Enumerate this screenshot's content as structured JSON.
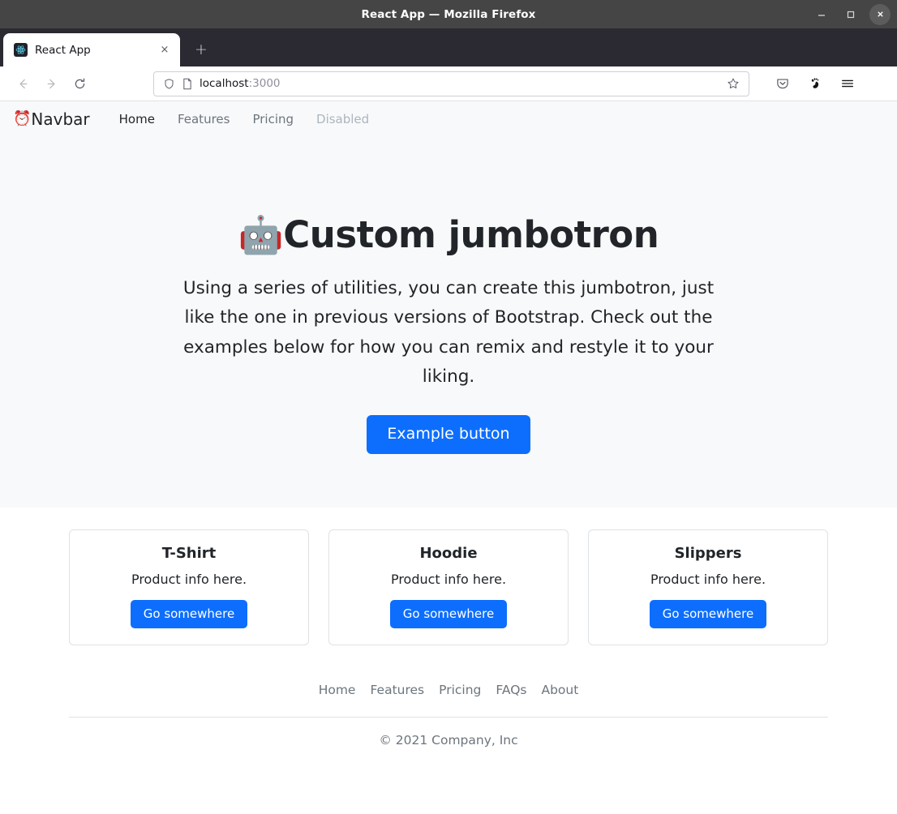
{
  "window": {
    "title": "React App — Mozilla Firefox",
    "controls": {
      "minimize": "minimize-icon",
      "maximize": "maximize-icon",
      "close": "close-icon"
    }
  },
  "tabs": {
    "items": [
      {
        "title": "React App",
        "favicon": "react-favicon",
        "close_label": "×"
      }
    ],
    "new_tab_label": "+"
  },
  "toolbar": {
    "back_icon": "back-arrow-icon",
    "forward_icon": "forward-arrow-icon",
    "reload_icon": "reload-icon",
    "shield_icon": "shield-icon",
    "page_icon": "page-icon",
    "url_host": "localhost",
    "url_port": ":3000",
    "bookmark_icon": "star-icon",
    "pocket_icon": "pocket-icon",
    "account_icon": "gnome-foot-icon",
    "menu_icon": "hamburger-menu-icon"
  },
  "navbar": {
    "brand_icon": "⏰",
    "brand": "Navbar",
    "links": [
      {
        "label": "Home",
        "state": "active"
      },
      {
        "label": "Features",
        "state": "normal"
      },
      {
        "label": "Pricing",
        "state": "normal"
      },
      {
        "label": "Disabled",
        "state": "disabled"
      }
    ]
  },
  "jumbotron": {
    "emoji": "🤖",
    "title": "Custom jumbotron",
    "text": "Using a series of utilities, you can create this jumbotron, just like the one in previous versions of Bootstrap. Check out the examples below for how you can remix and restyle it to your liking.",
    "button_label": "Example button"
  },
  "cards": [
    {
      "title": "T-Shirt",
      "text": "Product info here.",
      "button_label": "Go somewhere"
    },
    {
      "title": "Hoodie",
      "text": "Product info here.",
      "button_label": "Go somewhere"
    },
    {
      "title": "Slippers",
      "text": "Product info here.",
      "button_label": "Go somewhere"
    }
  ],
  "footer": {
    "links": [
      "Home",
      "Features",
      "Pricing",
      "FAQs",
      "About"
    ],
    "copyright": "© 2021 Company, Inc"
  },
  "colors": {
    "primary": "#0d6efd",
    "light_bg": "#f8f9fa",
    "titlebar": "#454545",
    "tabstrip": "#2b2a33",
    "muted_text": "#6c757d",
    "border": "#dee2e6"
  }
}
